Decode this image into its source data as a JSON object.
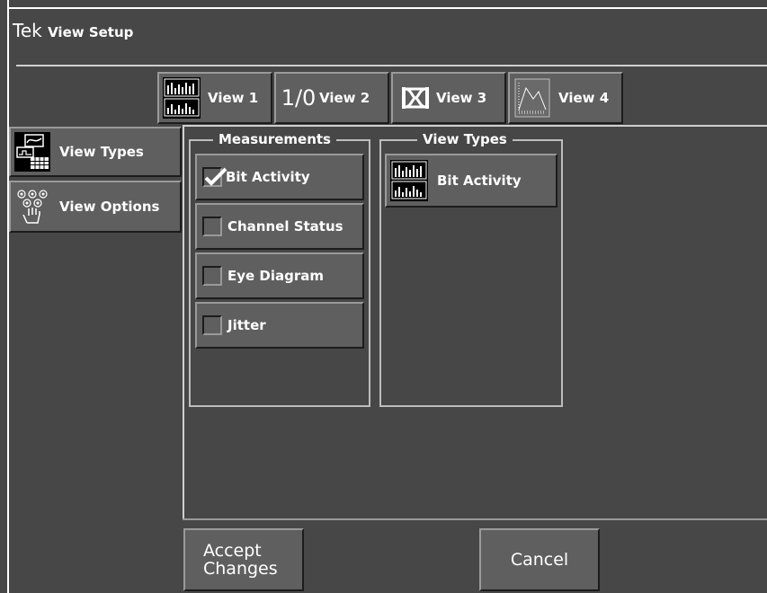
{
  "app": {
    "brand": "Tek",
    "title": "View Setup"
  },
  "view_tabs": [
    {
      "label": "View 1",
      "icon": "bar-graph-icon"
    },
    {
      "label": "View 2",
      "icon": "one-zero-icon",
      "icon_text": "1/0"
    },
    {
      "label": "View 3",
      "icon": "eye-diagram-icon"
    },
    {
      "label": "View 4",
      "icon": "jitter-plot-icon"
    }
  ],
  "sidebar": [
    {
      "label": "View Types",
      "icon": "view-types-icon"
    },
    {
      "label": "View Options",
      "icon": "view-options-icon"
    }
  ],
  "measurements": {
    "title": "Measurements",
    "items": [
      {
        "label": "Bit Activity",
        "checked": true
      },
      {
        "label": "Channel Status",
        "checked": false
      },
      {
        "label": "Eye Diagram",
        "checked": false
      },
      {
        "label": "Jitter",
        "checked": false
      }
    ]
  },
  "view_types": {
    "title": "View Types",
    "items": [
      {
        "label": "Bit Activity",
        "icon": "bar-graph-icon"
      }
    ]
  },
  "actions": {
    "accept": "Accept Changes",
    "cancel": "Cancel"
  }
}
